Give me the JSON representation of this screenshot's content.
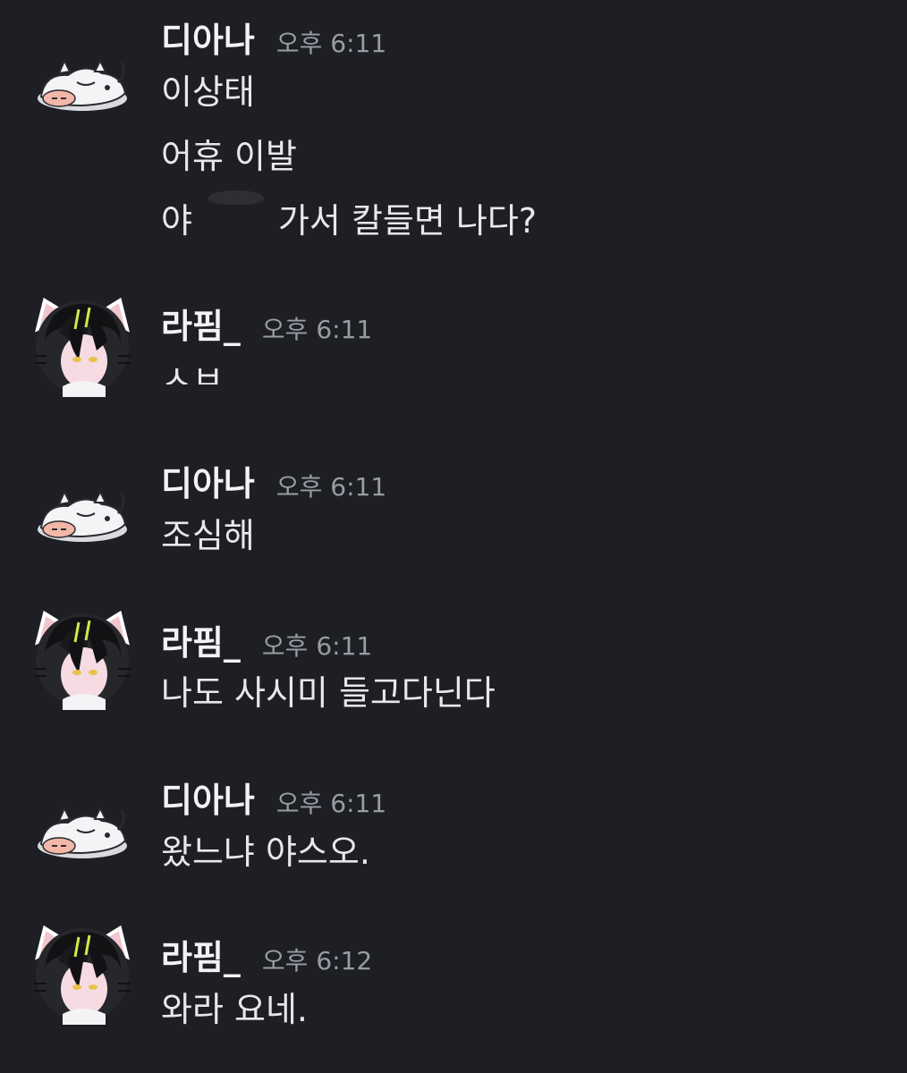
{
  "messages": [
    {
      "user": "디아나",
      "time": "오후 6:11",
      "avatar_icon": "sleeping-cat-avatar-icon",
      "lines": [
        "이상태",
        "어휴 이발",
        "야",
        "가서 칼들면 나다?"
      ]
    },
    {
      "user": "라핌_",
      "time": "오후 6:11",
      "avatar_icon": "cat-ear-anime-avatar-icon",
      "lines": [
        "ㅅㅂ"
      ]
    },
    {
      "user": "디아나",
      "time": "오후 6:11",
      "avatar_icon": "sleeping-cat-avatar-icon",
      "lines": [
        "조심해"
      ]
    },
    {
      "user": "라핌_",
      "time": "오후 6:11",
      "avatar_icon": "cat-ear-anime-avatar-icon",
      "lines": [
        "나도 사시미 들고다닌다"
      ]
    },
    {
      "user": "디아나",
      "time": "오후 6:11",
      "avatar_icon": "sleeping-cat-avatar-icon",
      "lines": [
        "왔느냐 야스오."
      ]
    },
    {
      "user": "라핌_",
      "time": "오후 6:12",
      "avatar_icon": "cat-ear-anime-avatar-icon",
      "lines": [
        "와라 요네."
      ]
    }
  ],
  "colors": {
    "background": "#1e1f24",
    "username": "#f2f3f5",
    "timestamp": "#9a9ca3",
    "message_text": "#e7e8ec"
  }
}
